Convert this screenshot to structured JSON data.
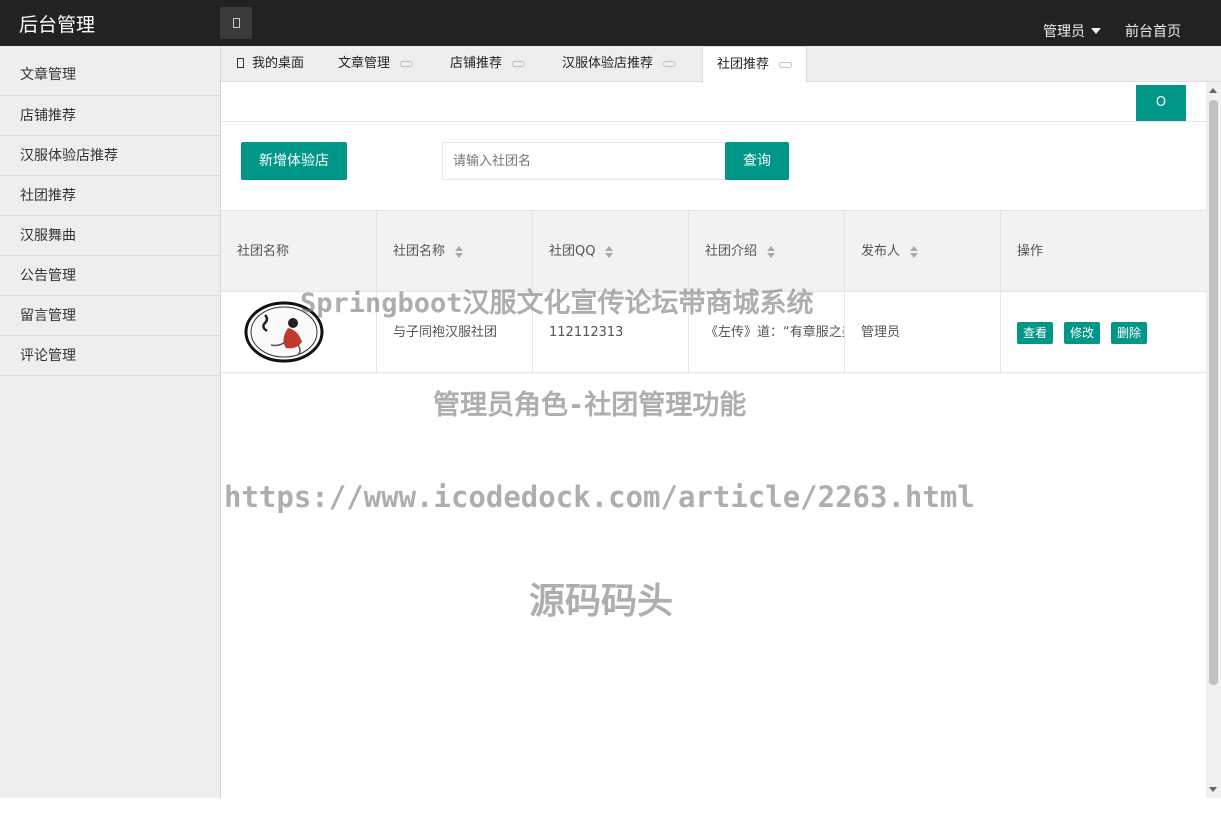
{
  "header": {
    "title": "后台管理",
    "user_menu": "管理员",
    "front_link": "前台首页"
  },
  "sidebar": {
    "items": [
      {
        "label": "文章管理"
      },
      {
        "label": "店铺推荐"
      },
      {
        "label": "汉服体验店推荐"
      },
      {
        "label": "社团推荐"
      },
      {
        "label": "汉服舞曲"
      },
      {
        "label": "公告管理"
      },
      {
        "label": "留言管理"
      },
      {
        "label": "评论管理"
      }
    ]
  },
  "tabs": [
    {
      "label": "我的桌面",
      "icon": "home-icon"
    },
    {
      "label": "文章管理"
    },
    {
      "label": "店铺推荐"
    },
    {
      "label": "汉服体验店推荐"
    },
    {
      "label": "社团推荐",
      "active": true
    }
  ],
  "toolbar": {
    "add_label": "新增体验店",
    "search_placeholder": "请输入社团名",
    "query_label": "查询",
    "refresh_icon": "refresh-icon",
    "refresh_glyph": "Ο"
  },
  "table": {
    "headers": [
      "社团名称",
      "社团名称",
      "社团QQ",
      "社团介绍",
      "发布人",
      "操作"
    ],
    "rows": [
      {
        "name": "与子同袍汉服社团",
        "qq": "112112313",
        "intro": "《左传》道：“有章服之美谓之华",
        "publisher": "管理员",
        "actions": [
          "查看",
          "修改",
          "删除"
        ]
      }
    ]
  },
  "watermark": {
    "line1": "Springboot汉服文化宣传论坛带商城系统",
    "line2": "管理员角色-社团管理功能",
    "line3": "https://www.icodedock.com/article/2263.html",
    "line4": "源码码头"
  },
  "colors": {
    "accent": "#009688",
    "header_bg": "#222222",
    "sidebar_bg": "#eeeeee"
  }
}
